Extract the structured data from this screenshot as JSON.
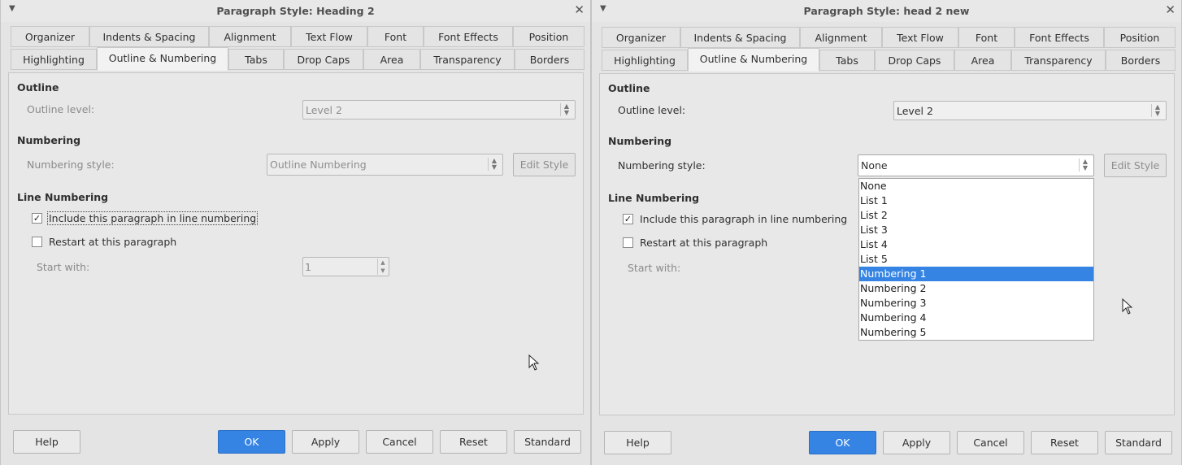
{
  "left_dialog": {
    "title": "Paragraph Style: Heading 2",
    "tabs_row1": [
      "Organizer",
      "Indents & Spacing",
      "Alignment",
      "Text Flow",
      "Font",
      "Font Effects",
      "Position"
    ],
    "tabs_row2": [
      "Highlighting",
      "Outline & Numbering",
      "Tabs",
      "Drop Caps",
      "Area",
      "Transparency",
      "Borders"
    ],
    "active_tab": "Outline & Numbering",
    "outline": {
      "heading": "Outline",
      "level_label": "Outline level:",
      "level_value": "Level 2"
    },
    "numbering": {
      "heading": "Numbering",
      "style_label": "Numbering style:",
      "style_value": "Outline Numbering",
      "edit_style": "Edit Style"
    },
    "line_numbering": {
      "heading": "Line Numbering",
      "include_label": "Include this paragraph in line numbering",
      "include_checked": true,
      "restart_label": "Restart at this paragraph",
      "restart_checked": false,
      "start_label": "Start with:",
      "start_value": "1"
    },
    "buttons": {
      "help": "Help",
      "ok": "OK",
      "apply": "Apply",
      "cancel": "Cancel",
      "reset": "Reset",
      "standard": "Standard"
    }
  },
  "right_dialog": {
    "title": "Paragraph Style: head 2 new",
    "tabs_row1": [
      "Organizer",
      "Indents & Spacing",
      "Alignment",
      "Text Flow",
      "Font",
      "Font Effects",
      "Position"
    ],
    "tabs_row2": [
      "Highlighting",
      "Outline & Numbering",
      "Tabs",
      "Drop Caps",
      "Area",
      "Transparency",
      "Borders"
    ],
    "active_tab": "Outline & Numbering",
    "outline": {
      "heading": "Outline",
      "level_label": "Outline level:",
      "level_value": "Level 2"
    },
    "numbering": {
      "heading": "Numbering",
      "style_label": "Numbering style:",
      "style_value": "None",
      "edit_style": "Edit Style",
      "options": [
        "None",
        "List 1",
        "List 2",
        "List 3",
        "List 4",
        "List 5",
        "Numbering 1",
        "Numbering 2",
        "Numbering 3",
        "Numbering 4",
        "Numbering 5"
      ],
      "highlighted_option": "Numbering 1"
    },
    "line_numbering": {
      "heading": "Line Numbering",
      "include_label": "Include this paragraph in line numbering",
      "include_checked": true,
      "restart_label": "Restart at this paragraph",
      "restart_checked": false,
      "start_label": "Start with:"
    },
    "buttons": {
      "help": "Help",
      "ok": "OK",
      "apply": "Apply",
      "cancel": "Cancel",
      "reset": "Reset",
      "standard": "Standard"
    }
  },
  "icons": {
    "menu": "chevron-down-icon",
    "close": "close-icon",
    "check": "checkmark-icon",
    "spin": "spin-arrows-icon",
    "cursor": "mouse-pointer-icon"
  },
  "colors": {
    "accent": "#3584e4",
    "panel": "#e8e8e8"
  }
}
